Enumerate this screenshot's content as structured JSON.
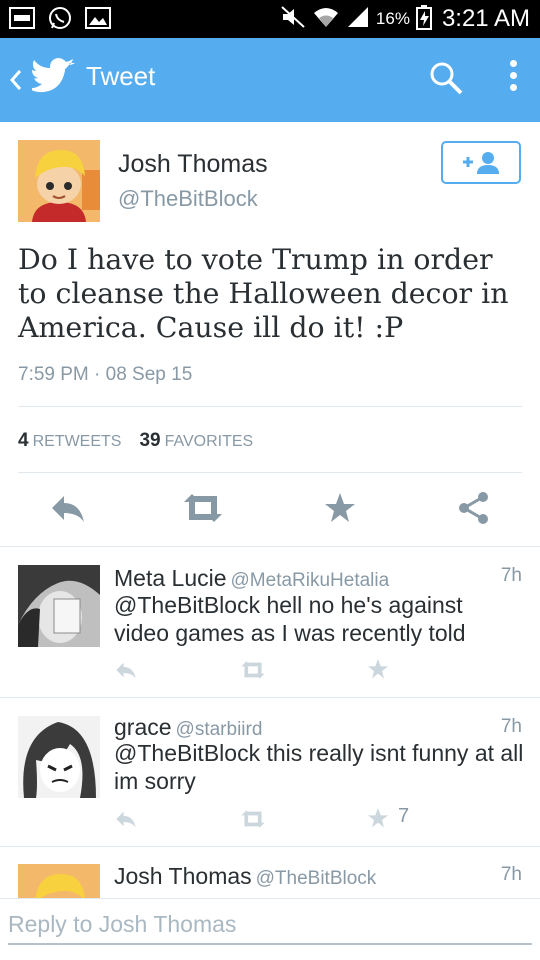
{
  "status_bar": {
    "battery_percent": "16%",
    "time": "3:21 AM",
    "left_icons": [
      "voicemail-icon",
      "whatsapp-icon",
      "gallery-icon"
    ],
    "right_icons": [
      "mute-icon",
      "wifi-icon",
      "signal-icon",
      "battery-icon"
    ]
  },
  "app_bar": {
    "title": "Tweet",
    "background": "#55acee",
    "icons": [
      "back-icon",
      "twitter-bird-icon",
      "search-icon",
      "overflow-menu-icon"
    ]
  },
  "tweet": {
    "name": "Josh Thomas",
    "handle": "@TheBitBlock",
    "follow_icon": "follow-user-icon",
    "text": "Do I have to vote Trump in order to cleanse the Halloween decor in America. Cause ill do it! :P",
    "timestamp": "7:59 PM · 08 Sep 15",
    "retweets_count": "4",
    "retweets_label": "RETWEETS",
    "favorites_count": "39",
    "favorites_label": "FAVORITES",
    "actions": [
      "reply-icon",
      "retweet-icon",
      "favorite-icon",
      "share-icon"
    ]
  },
  "replies": [
    {
      "name": "Meta Lucie",
      "handle": "@MetaRikuHetalia",
      "age": "7h",
      "text": "@TheBitBlock hell no he's against video games as I was recently told",
      "favorites": ""
    },
    {
      "name": "grace",
      "handle": "@starbiird",
      "age": "7h",
      "text": "@TheBitBlock this really isnt funny at all im sorry",
      "favorites": "7"
    },
    {
      "name": "Josh Thomas",
      "handle": "@TheBitBlock",
      "age": "7h",
      "text": "",
      "favorites": ""
    }
  ],
  "reply_box": {
    "placeholder": "Reply to Josh Thomas"
  }
}
